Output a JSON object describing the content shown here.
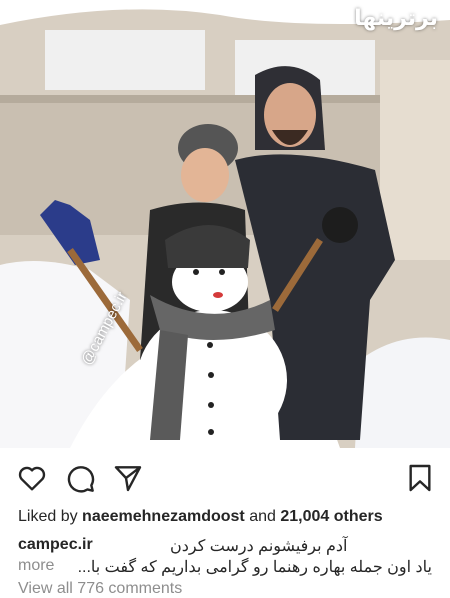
{
  "photo": {
    "watermark_site": "برترینها",
    "camera_watermark": "@campec.ir"
  },
  "actions": {
    "like_icon": "heart-icon",
    "comment_icon": "comment-icon",
    "share_icon": "send-icon",
    "save_icon": "bookmark-icon"
  },
  "likes": {
    "prefix": "Liked by ",
    "user": "naeemehnezamdoost",
    "suffix": " and ",
    "count": "21,004 others"
  },
  "caption": {
    "owner": "campec.ir",
    "line1": "آدم برفیشونم درست کردن",
    "line2": "یاد اون جمله بهاره رهنما رو گرامی بداریم که گفت با...",
    "more": "more"
  },
  "comments": {
    "view_all": "View all 776 comments"
  }
}
